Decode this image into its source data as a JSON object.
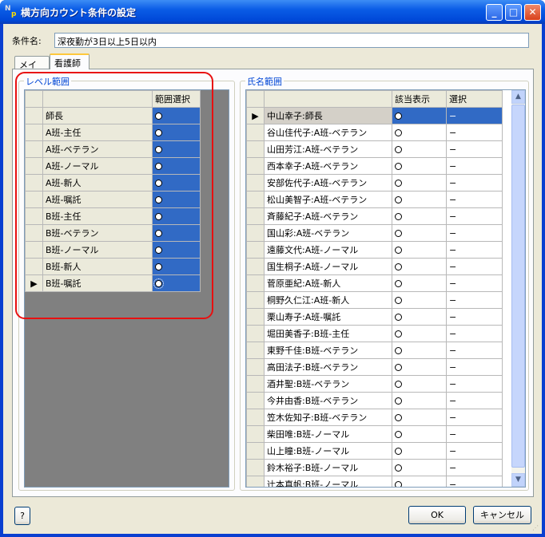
{
  "window": {
    "title": "横方向カウント条件の設定",
    "icon": "np-app-icon",
    "controls": [
      "minimize-icon",
      "maximize-icon",
      "close-icon"
    ]
  },
  "condition": {
    "label": "条件名:",
    "value": "深夜勤が3日以上5日以内"
  },
  "tabs": [
    {
      "label": "メイン",
      "active": false
    },
    {
      "label": "看護師",
      "active": true
    }
  ],
  "level_group": {
    "title": "レベル範囲",
    "column_header": "範囲選択",
    "rows": [
      {
        "label": "師長",
        "mark": "○"
      },
      {
        "label": "A班-主任",
        "mark": "○"
      },
      {
        "label": "A班-ベテラン",
        "mark": "○"
      },
      {
        "label": "A班-ノーマル",
        "mark": "○"
      },
      {
        "label": "A班-新人",
        "mark": "○"
      },
      {
        "label": "A班-嘱託",
        "mark": "○"
      },
      {
        "label": "B班-主任",
        "mark": "○"
      },
      {
        "label": "B班-ベテラン",
        "mark": "○"
      },
      {
        "label": "B班-ノーマル",
        "mark": "○"
      },
      {
        "label": "B班-新人",
        "mark": "○"
      },
      {
        "label": "B班-嘱託",
        "mark": "○",
        "current": true
      }
    ]
  },
  "name_group": {
    "title": "氏名範囲",
    "columns": [
      "該当表示",
      "選択"
    ],
    "rows": [
      {
        "name": "中山幸子:師長",
        "show": "○",
        "select": "−",
        "current": true
      },
      {
        "name": "谷山佳代子:A班-ベテラン",
        "show": "○",
        "select": "−"
      },
      {
        "name": "山田芳江:A班-ベテラン",
        "show": "○",
        "select": "−"
      },
      {
        "name": "西本幸子:A班-ベテラン",
        "show": "○",
        "select": "−"
      },
      {
        "name": "安部佐代子:A班-ベテラン",
        "show": "○",
        "select": "−"
      },
      {
        "name": "松山美智子:A班-ベテラン",
        "show": "○",
        "select": "−"
      },
      {
        "name": "斉藤紀子:A班-ベテラン",
        "show": "○",
        "select": "−"
      },
      {
        "name": "国山彩:A班-ベテラン",
        "show": "○",
        "select": "−"
      },
      {
        "name": "遠藤文代:A班-ノーマル",
        "show": "○",
        "select": "−"
      },
      {
        "name": "国生桐子:A班-ノーマル",
        "show": "○",
        "select": "−"
      },
      {
        "name": "菅原亜紀:A班-新人",
        "show": "○",
        "select": "−"
      },
      {
        "name": "桐野久仁江:A班-新人",
        "show": "○",
        "select": "−"
      },
      {
        "name": "栗山寿子:A班-嘱託",
        "show": "○",
        "select": "−"
      },
      {
        "name": "堀田美香子:B班-主任",
        "show": "○",
        "select": "−"
      },
      {
        "name": "東野千佳:B班-ベテラン",
        "show": "○",
        "select": "−"
      },
      {
        "name": "高田法子:B班-ベテラン",
        "show": "○",
        "select": "−"
      },
      {
        "name": "酒井聖:B班-ベテラン",
        "show": "○",
        "select": "−"
      },
      {
        "name": "今井由香:B班-ベテラン",
        "show": "○",
        "select": "−"
      },
      {
        "name": "笠木佐知子:B班-ベテラン",
        "show": "○",
        "select": "−"
      },
      {
        "name": "柴田唯:B班-ノーマル",
        "show": "○",
        "select": "−"
      },
      {
        "name": "山上瞳:B班-ノーマル",
        "show": "○",
        "select": "−"
      },
      {
        "name": "鈴木裕子:B班-ノーマル",
        "show": "○",
        "select": "−"
      },
      {
        "name": "辻本真帆:B班-ノーマル",
        "show": "○",
        "select": "−"
      }
    ]
  },
  "footer": {
    "help_label": "?",
    "ok_label": "OK",
    "cancel_label": "キャンセル"
  },
  "colors": {
    "selection_blue": "#316ac5",
    "highlight_red": "#e81010",
    "titlebar_blue": "#0a5ce6"
  }
}
